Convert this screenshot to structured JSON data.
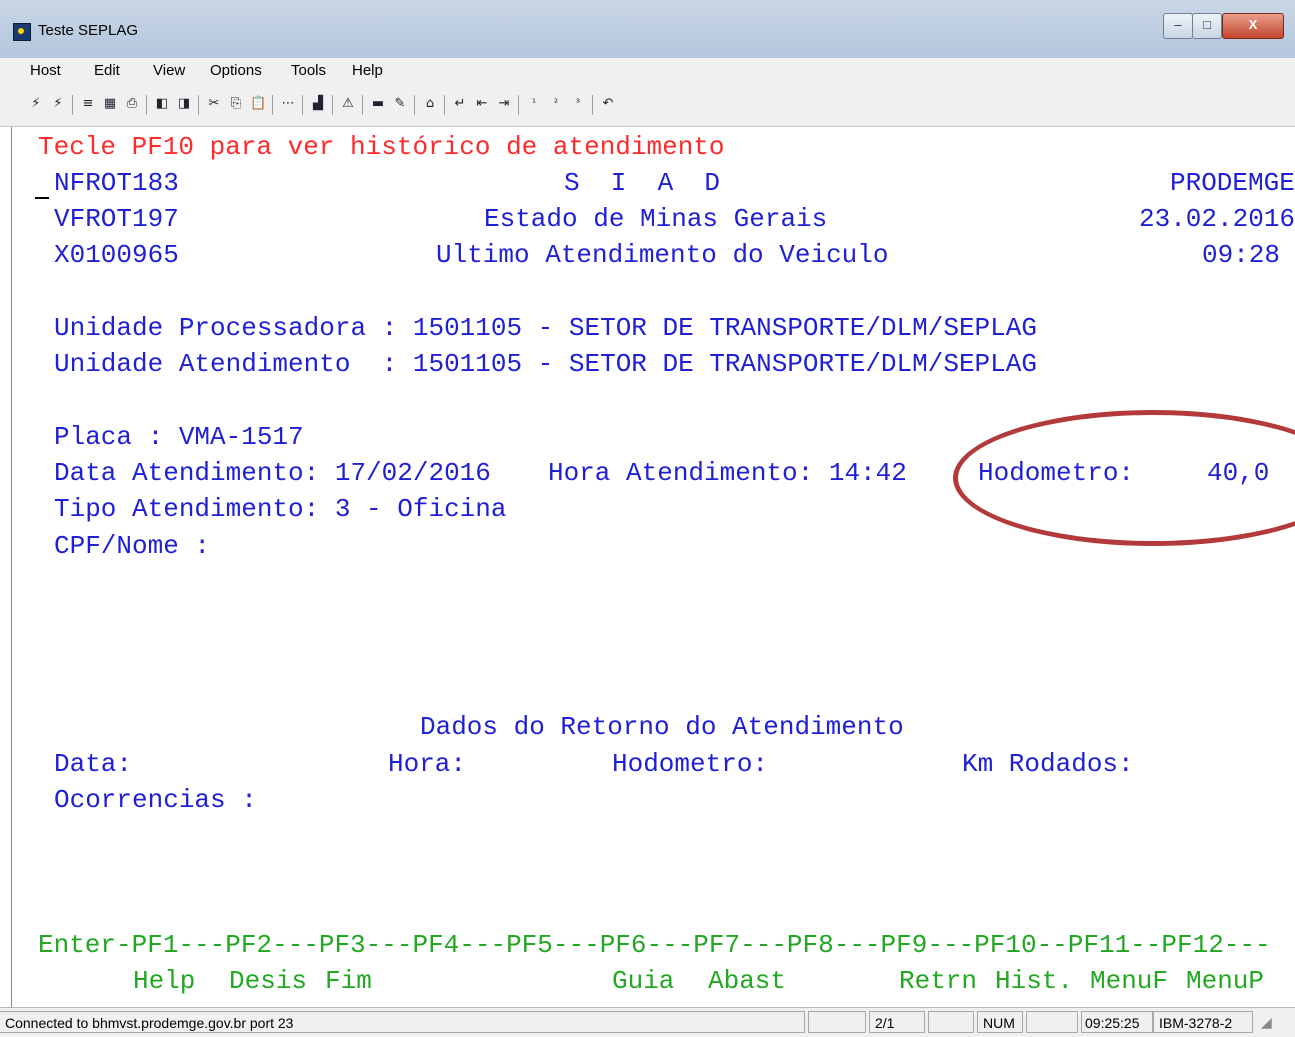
{
  "window": {
    "title": "Teste SEPLAG",
    "buttons": {
      "minimize": "–",
      "maximize": "□",
      "close": "X"
    }
  },
  "menu": [
    "Host",
    "Edit",
    "View",
    "Options",
    "Tools",
    "Help"
  ],
  "terminal": {
    "hint": "Tecle PF10 para ver histórico de atendimento",
    "header": {
      "line1_left": "NFROT183",
      "line1_center": "S  I  A  D",
      "line1_right": "PRODEMGE",
      "line2_left": "VFROT197",
      "line2_center": "Estado de Minas Gerais",
      "line2_right": "23.02.2016",
      "line3_left": "X0100965",
      "line3_center": "Ultimo Atendimento do Veiculo",
      "line3_right": "09:28"
    },
    "unidade_processadora": "Unidade Processadora : 1501105 - SETOR DE TRANSPORTE/DLM/SEPLAG",
    "unidade_atendimento": "Unidade Atendimento  : 1501105 - SETOR DE TRANSPORTE/DLM/SEPLAG",
    "placa": "Placa : VMA-1517",
    "data_atendimento": "Data Atendimento: 17/02/2016",
    "hora_atendimento": "Hora Atendimento: 14:42",
    "hodometro_label": "Hodometro:",
    "hodometro_value": "40,0",
    "tipo_atendimento": "Tipo Atendimento: 3 - Oficina",
    "cpf_nome": "CPF/Nome :",
    "retorno_title": "Dados do Retorno do Atendimento",
    "retorno_data": "Data:",
    "retorno_hora": "Hora:",
    "retorno_hodometro": "Hodometro:",
    "retorno_km": "Km Rodados:",
    "ocorrencias": "Ocorrencias :",
    "pf_line": "Enter-PF1---PF2---PF3---PF4---PF5---PF6---PF7---PF8---PF9---PF10--PF11--PF12---",
    "pf_labels": {
      "help": "Help",
      "desis": "Desis",
      "fim": "Fim",
      "guia": "Guia",
      "abast": "Abast",
      "retrn": "Retrn",
      "hist": "Hist.",
      "menuf": "MenuF",
      "menup": "MenuP"
    }
  },
  "status": {
    "connection": "Connected to bhmvst.prodemge.gov.br port 23",
    "page": "2/1",
    "num": "NUM",
    "time": "09:25:25",
    "model": "IBM-3278-2"
  },
  "annotation_color": "#b23a3a"
}
